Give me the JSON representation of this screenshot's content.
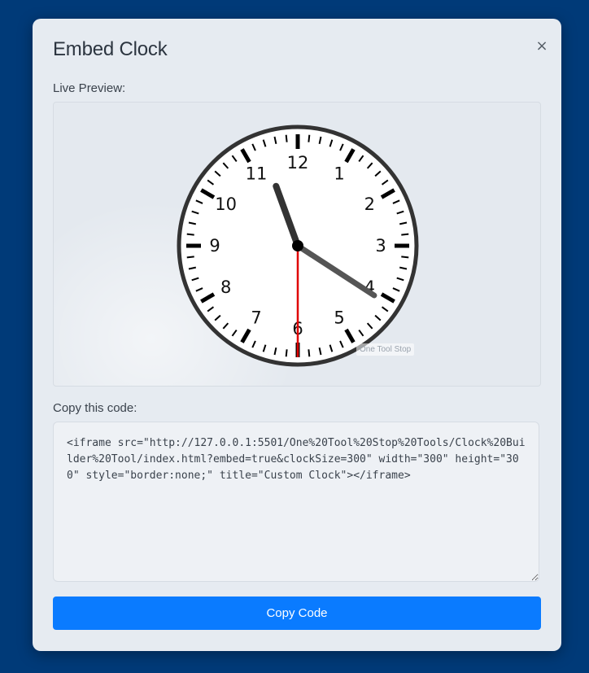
{
  "modal": {
    "title": "Embed Clock",
    "close_label": "×",
    "preview_label": "Live Preview:",
    "code_label": "Copy this code:",
    "embed_code": "<iframe src=\"http://127.0.0.1:5501/One%20Tool%20Stop%20Tools/Clock%20Builder%20Tool/index.html?embed=true&clockSize=300\" width=\"300\" height=\"300\" style=\"border:none;\" title=\"Custom Clock\"></iframe>",
    "copy_button_label": "Copy Code"
  },
  "clock": {
    "numbers": [
      "12",
      "1",
      "2",
      "3",
      "4",
      "5",
      "6",
      "7",
      "8",
      "9",
      "10",
      "11"
    ],
    "time": {
      "hours": 11,
      "minutes": 20,
      "seconds": 30
    },
    "watermark": "One Tool Stop",
    "colors": {
      "face": "#ffffff",
      "rim": "#333333",
      "hour_hand": "#333333",
      "minute_hand": "#555555",
      "second_hand": "#e00000",
      "ticks": "#000000"
    }
  },
  "accent_color": "#0a7bff"
}
